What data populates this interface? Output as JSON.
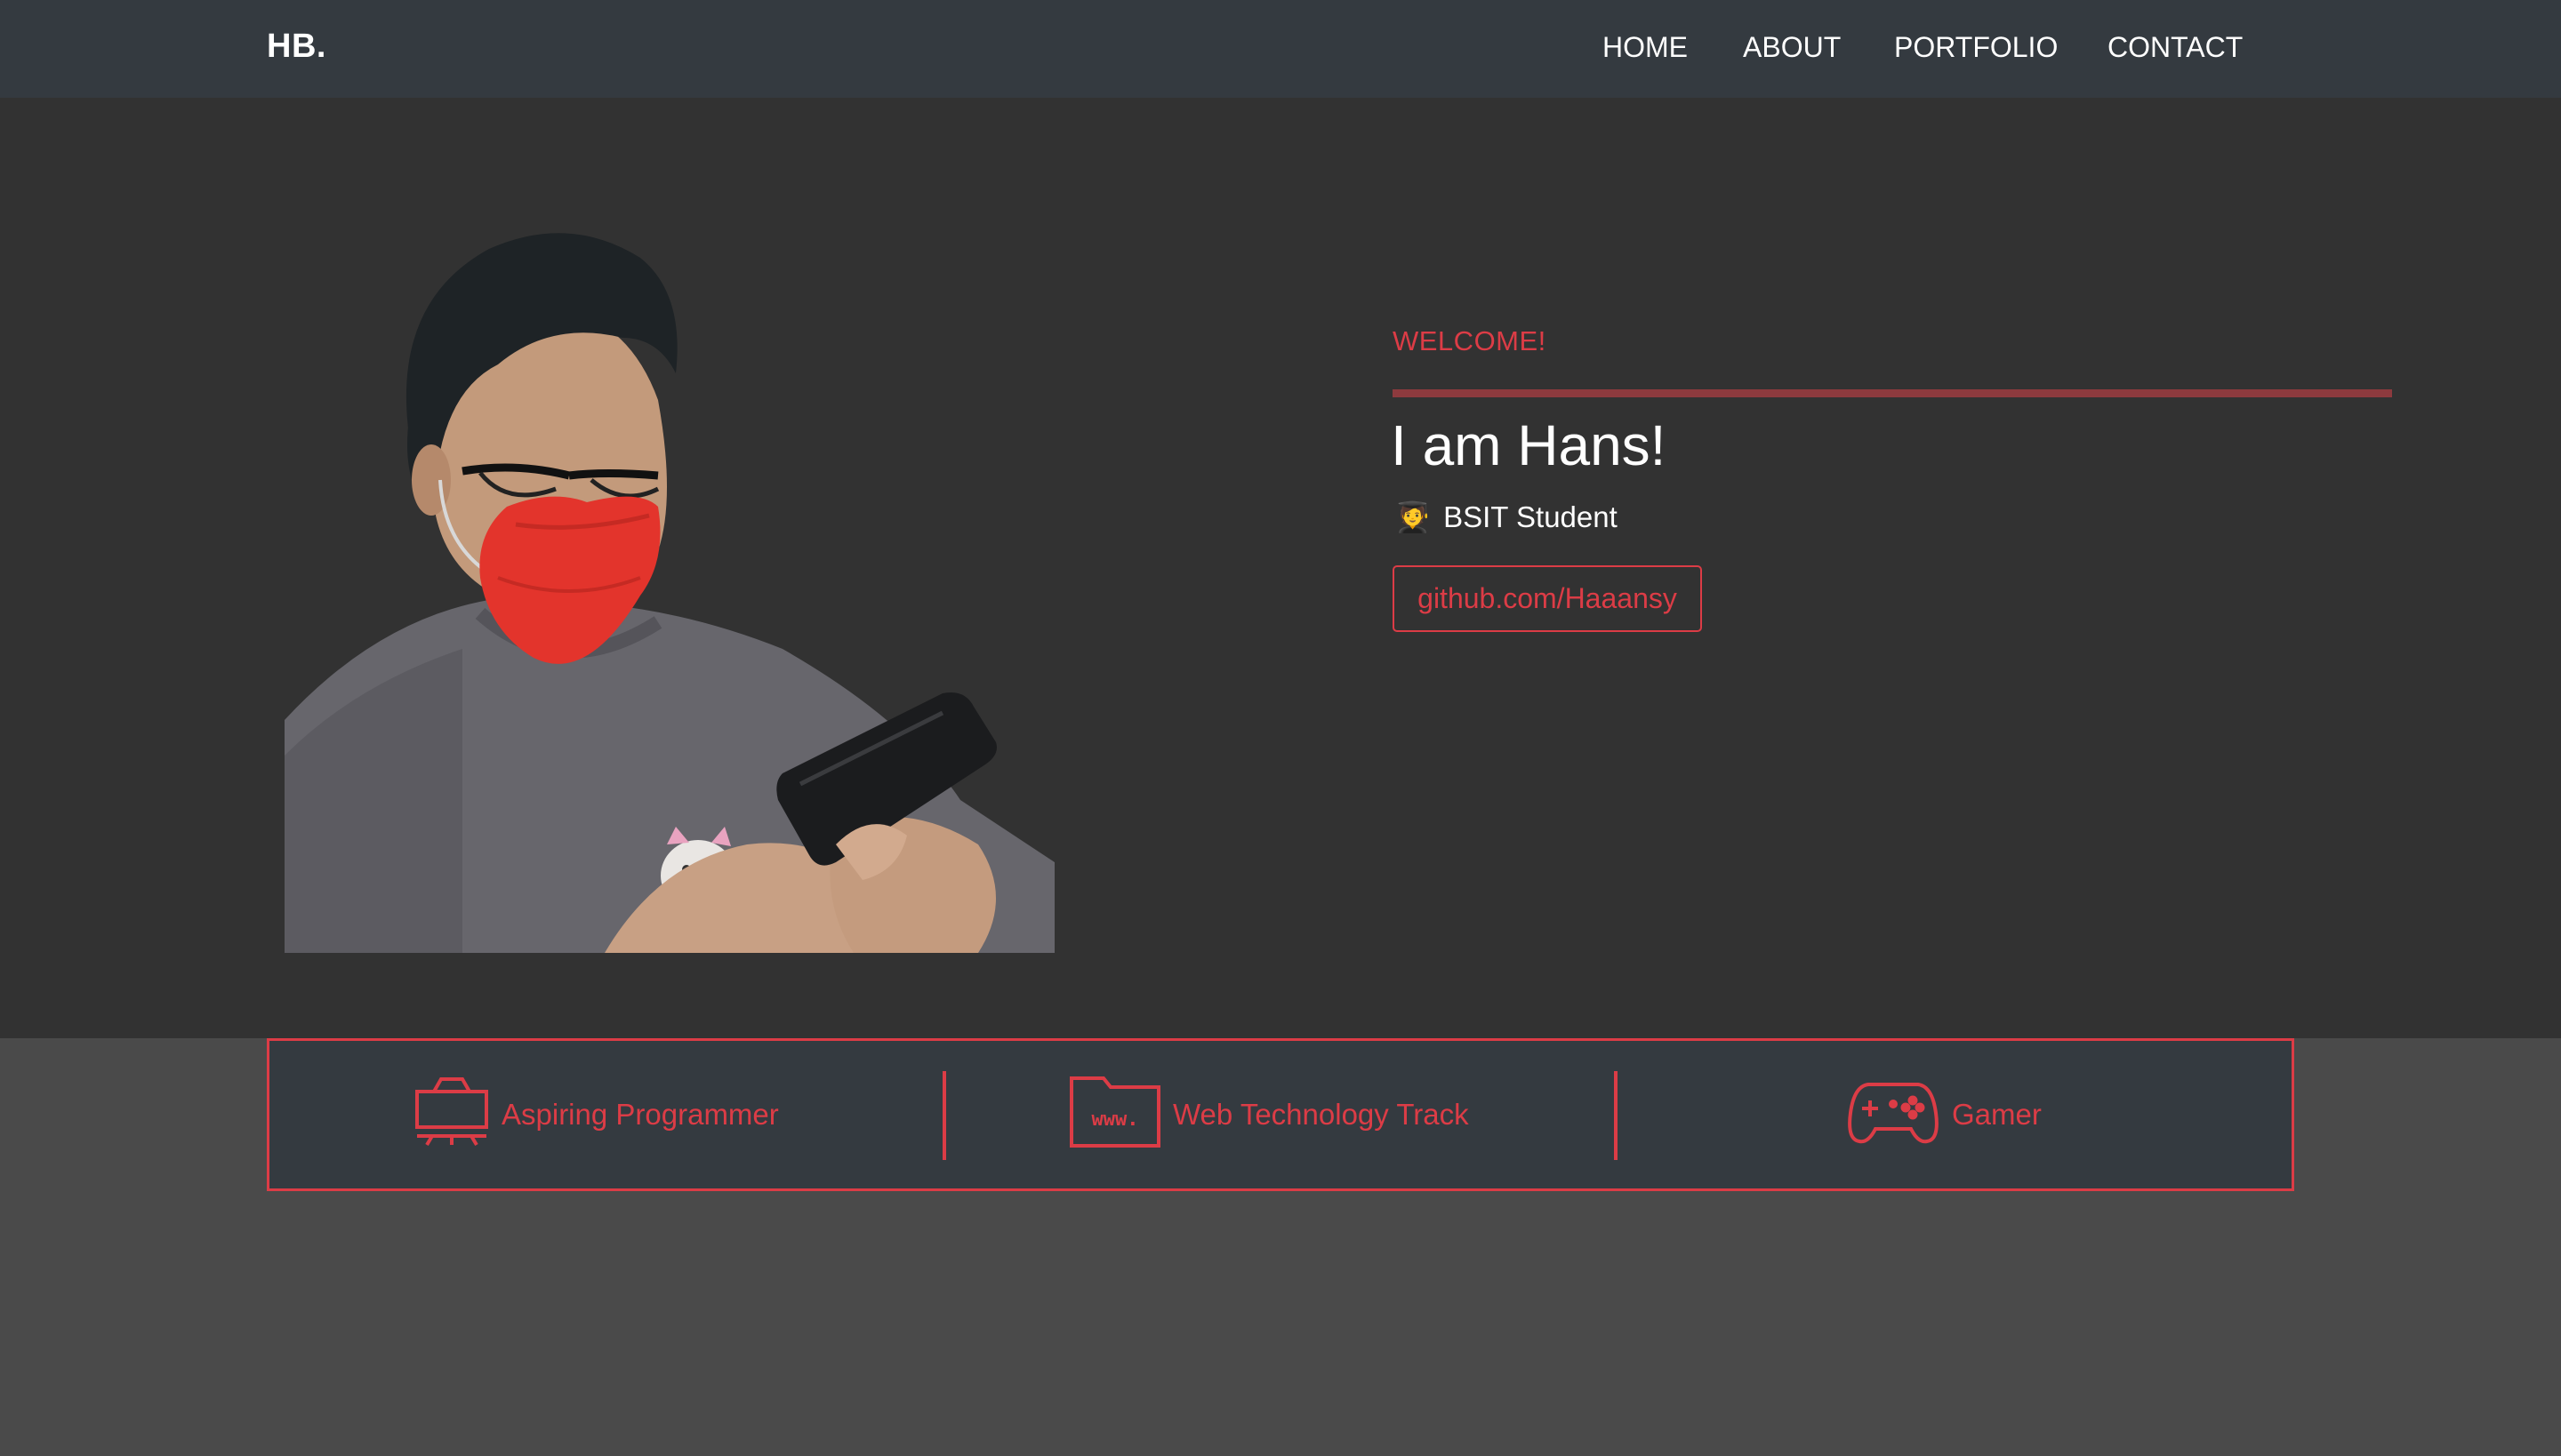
{
  "navbar": {
    "brand": "HB.",
    "links": [
      {
        "label": "HOME"
      },
      {
        "label": "ABOUT"
      },
      {
        "label": "PORTFOLIO"
      },
      {
        "label": "CONTACT"
      }
    ]
  },
  "hero": {
    "welcome": "WELCOME!",
    "headline": "I am Hans!",
    "subtitle_emoji": "🧑‍🎓",
    "subtitle": "BSIT Student",
    "github_button": "github.com/Haaansy"
  },
  "features": [
    {
      "icon": "monitor-icon",
      "label": "Aspiring Programmer"
    },
    {
      "icon": "www-folder-icon",
      "label": "Web Technology Track"
    },
    {
      "icon": "gamepad-icon",
      "label": "Gamer"
    }
  ],
  "colors": {
    "navbar_bg": "#343a40",
    "hero_bg": "#323232",
    "page_bg": "#4a4a4a",
    "accent": "#dc3c46",
    "rule": "#8d3a3e",
    "text": "#ffffff"
  }
}
